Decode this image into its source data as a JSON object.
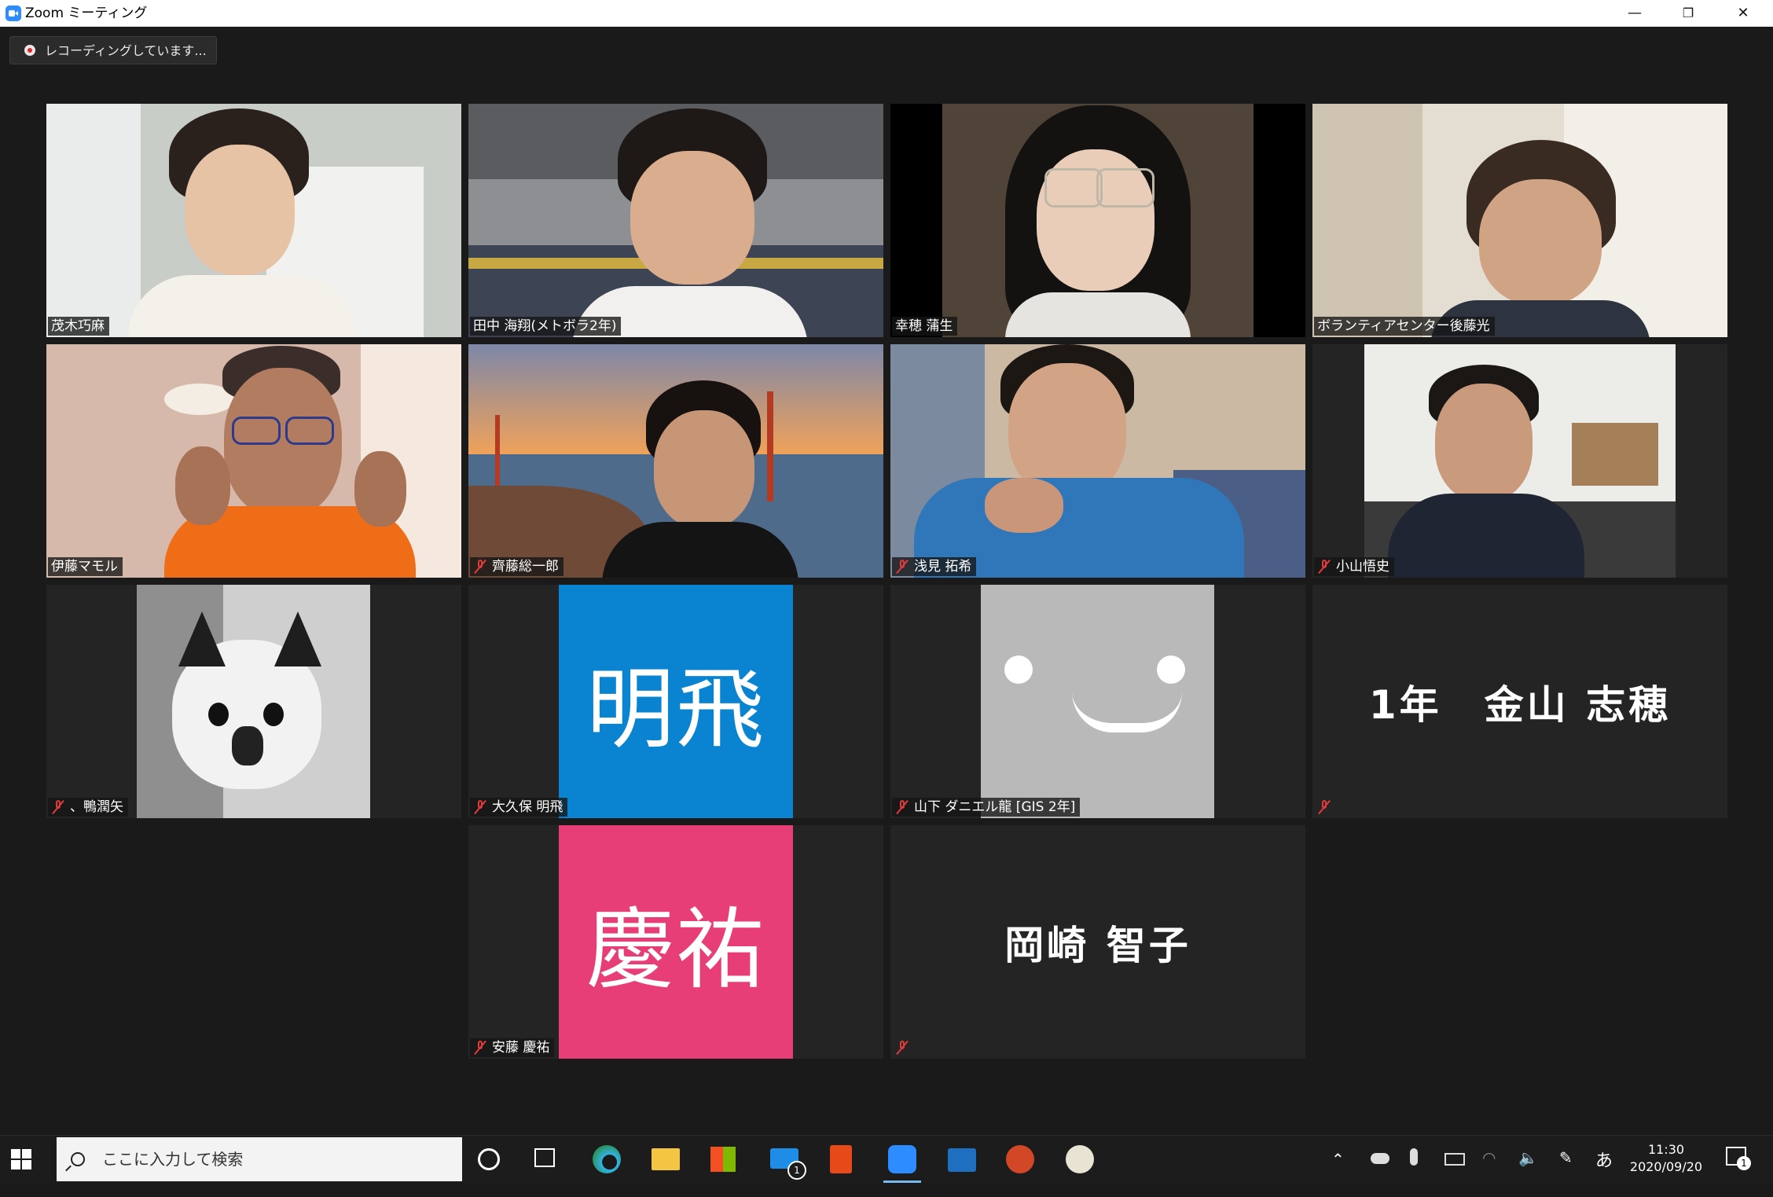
{
  "window": {
    "title": "Zoom ミーティング",
    "minimize": "—",
    "restore": "❐",
    "close": "✕"
  },
  "recording": {
    "label": "レコーディングしています..."
  },
  "participants": [
    {
      "name": "茂木巧麻",
      "muted": false
    },
    {
      "name": "田中 海翔(メトボラ2年)",
      "muted": false
    },
    {
      "name": "幸穂 蒲生",
      "muted": false
    },
    {
      "name": "ボランティアセンター後藤光",
      "muted": false
    },
    {
      "name": "伊藤マモル",
      "muted": false,
      "speaking": true
    },
    {
      "name": "齊藤総一郎",
      "muted": true
    },
    {
      "name": "浅見 拓希",
      "muted": true
    },
    {
      "name": "小山悟史",
      "muted": true
    },
    {
      "name": "、鴨潤矢",
      "muted": true
    },
    {
      "name": "大久保 明飛",
      "muted": true,
      "avatar_text": "明飛",
      "avatar_color": "#0a84d0"
    },
    {
      "name": "山下 ダニエル龍 [GIS 2年]",
      "muted": true
    },
    {
      "name": "",
      "muted": true,
      "display_text": "1年　金山 志穂"
    },
    {
      "name": "安藤 慶祐",
      "muted": true,
      "avatar_text": "慶祐",
      "avatar_color": "#e83e78"
    },
    {
      "name": "",
      "muted": true,
      "display_text": "岡崎 智子"
    }
  ],
  "taskbar": {
    "search_placeholder": "ここに入力して検索",
    "ime": "あ",
    "time": "11:30",
    "date": "2020/09/20",
    "mail_badge": "1",
    "notification_badge": "1"
  }
}
